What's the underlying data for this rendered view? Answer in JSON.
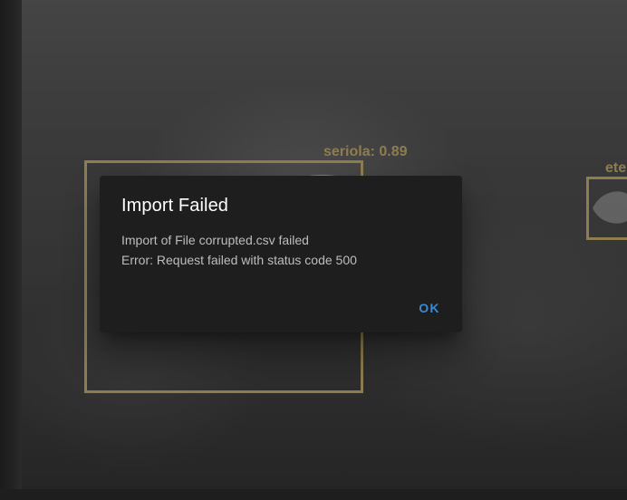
{
  "detections": [
    {
      "label": "seriola: 0.89"
    },
    {
      "label": "ete"
    }
  ],
  "dialog": {
    "title": "Import Failed",
    "message_line1": "Import of File corrupted.csv failed",
    "message_line2": "Error: Request failed with status code 500",
    "ok_label": "OK"
  },
  "colors": {
    "detection_box": "#8e7d4f",
    "dialog_background": "#1e1e1e",
    "button_text": "#3a8ad6"
  }
}
